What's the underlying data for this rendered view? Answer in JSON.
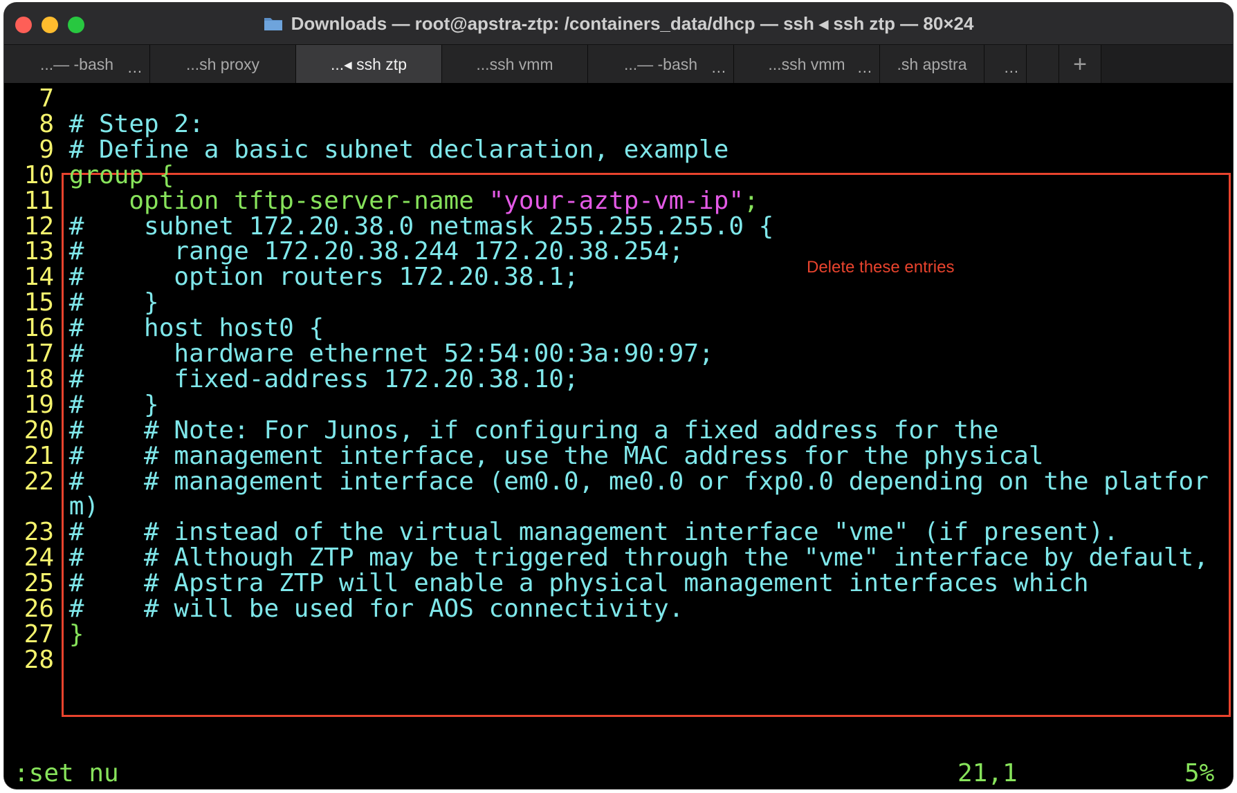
{
  "window": {
    "title": "Downloads — root@apstra-ztp: /containers_data/dhcp — ssh ◂ ssh ztp — 80×24"
  },
  "tabs": [
    {
      "label": "...— -bash",
      "more": "..."
    },
    {
      "label": "...sh proxy",
      "more": ""
    },
    {
      "label": "...◂ ssh ztp",
      "more": ""
    },
    {
      "label": "...ssh vmm",
      "more": ""
    },
    {
      "label": "...— -bash",
      "more": "..."
    },
    {
      "label": "...ssh vmm",
      "more": "..."
    },
    {
      "label": ".sh apstra",
      "more": ""
    },
    {
      "label": "",
      "more": "..."
    },
    {
      "label": "",
      "more": ""
    },
    {
      "label": "+",
      "more": ""
    }
  ],
  "editor": {
    "lines": [
      {
        "n": "7",
        "segs": [
          {
            "t": "",
            "c": "cyan"
          }
        ]
      },
      {
        "n": "8",
        "segs": [
          {
            "t": "# Step 2:",
            "c": "cyan"
          }
        ]
      },
      {
        "n": "9",
        "segs": [
          {
            "t": "# Define a basic subnet declaration, example",
            "c": "cyan"
          }
        ]
      },
      {
        "n": "10",
        "segs": [
          {
            "t": "group {",
            "c": "green"
          }
        ]
      },
      {
        "n": "11",
        "segs": [
          {
            "t": "    option tftp-server-name ",
            "c": "green"
          },
          {
            "t": "\"your-aztp-vm-ip\"",
            "c": "pink"
          },
          {
            "t": ";",
            "c": "green"
          }
        ]
      },
      {
        "n": "12",
        "segs": [
          {
            "t": "#    subnet 172.20.38.0 netmask 255.255.255.0 {",
            "c": "cyan"
          }
        ]
      },
      {
        "n": "13",
        "segs": [
          {
            "t": "#      range 172.20.38.244 172.20.38.254;",
            "c": "cyan"
          }
        ]
      },
      {
        "n": "14",
        "segs": [
          {
            "t": "#      option routers 172.20.38.1;",
            "c": "cyan"
          }
        ]
      },
      {
        "n": "15",
        "segs": [
          {
            "t": "#    }",
            "c": "cyan"
          }
        ]
      },
      {
        "n": "16",
        "segs": [
          {
            "t": "#    host host0 {",
            "c": "cyan"
          }
        ]
      },
      {
        "n": "17",
        "segs": [
          {
            "t": "#      hardware ethernet 52:54:00:3a:90:97;",
            "c": "cyan"
          }
        ]
      },
      {
        "n": "18",
        "segs": [
          {
            "t": "#      fixed-address 172.20.38.10;",
            "c": "cyan"
          }
        ]
      },
      {
        "n": "19",
        "segs": [
          {
            "t": "#    }",
            "c": "cyan"
          }
        ]
      },
      {
        "n": "20",
        "segs": [
          {
            "t": "#    # Note: For Junos, if configuring a fixed address for the",
            "c": "cyan"
          }
        ]
      },
      {
        "n": "21",
        "segs": [
          {
            "t": "#    # management interface, use the MAC address for the physical",
            "c": "cyan"
          }
        ]
      },
      {
        "n": "22",
        "segs": [
          {
            "t": "#    # management interface (em0.0, me0.0 or fxp0.0 depending on the platfor",
            "c": "cyan"
          }
        ]
      },
      {
        "n": "",
        "segs": [
          {
            "t": "m)",
            "c": "cyan"
          }
        ]
      },
      {
        "n": "23",
        "segs": [
          {
            "t": "#    # instead of the virtual management interface \"vme\" (if present).",
            "c": "cyan"
          }
        ]
      },
      {
        "n": "24",
        "segs": [
          {
            "t": "#    # Although ZTP may be triggered through the \"vme\" interface by default,",
            "c": "cyan"
          }
        ]
      },
      {
        "n": "25",
        "segs": [
          {
            "t": "#    # Apstra ZTP will enable a physical management interfaces which",
            "c": "cyan"
          }
        ]
      },
      {
        "n": "26",
        "segs": [
          {
            "t": "#    # will be used for AOS connectivity.",
            "c": "cyan"
          }
        ]
      },
      {
        "n": "27",
        "segs": [
          {
            "t": "}",
            "c": "green"
          }
        ]
      },
      {
        "n": "28",
        "segs": [
          {
            "t": "",
            "c": "cyan"
          }
        ]
      }
    ],
    "annotation": "Delete these entries",
    "command": ":set nu",
    "cursor_pos": "21,1",
    "scroll_pct": "5%"
  },
  "colors": {
    "line_number": "#f5f36d",
    "comment": "#7fe7ea",
    "keyword": "#87e35b",
    "string": "#e45ae6",
    "annotation": "#e8432d"
  }
}
